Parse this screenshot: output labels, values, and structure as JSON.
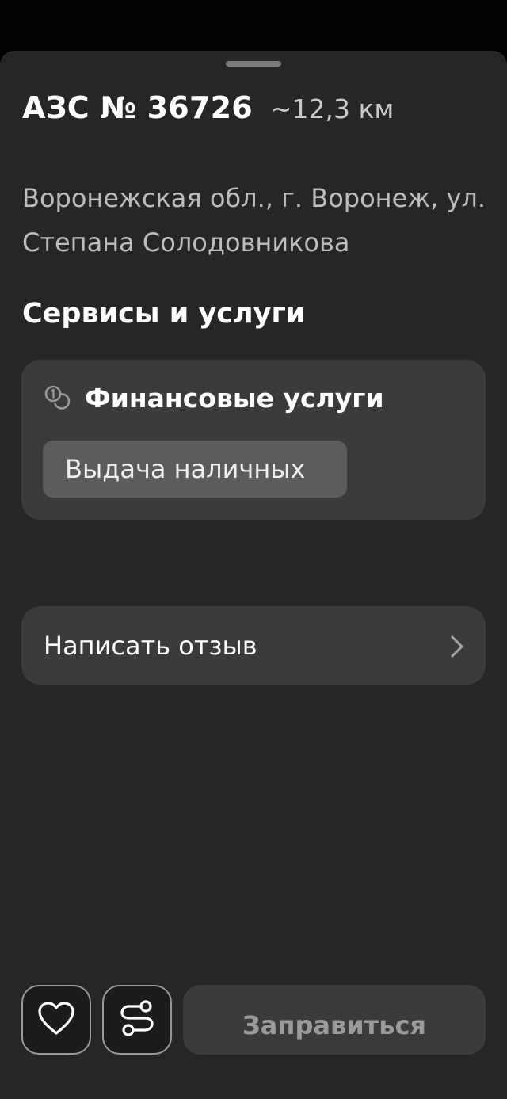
{
  "station": {
    "name": "АЗС № 36726",
    "distance": "~12,3 км",
    "address": "Воронежская обл., г. Воронеж, ул. Степана Солодовникова"
  },
  "services": {
    "section_title": "Сервисы и услуги",
    "categories": [
      {
        "title": "Финансовые услуги",
        "icon": "coins-icon",
        "items": [
          "Выдача наличных"
        ]
      }
    ]
  },
  "review": {
    "label": "Написать отзыв",
    "icon": "chevron-right-icon"
  },
  "actions": {
    "favorite_icon": "heart-icon",
    "route_icon": "route-icon",
    "refuel_label": "Заправиться"
  },
  "colors": {
    "sheet_background": "#262626",
    "card_background": "#3b3b3b",
    "chip_background": "#5c5c5c",
    "secondary_text": "#bdbdbd"
  }
}
